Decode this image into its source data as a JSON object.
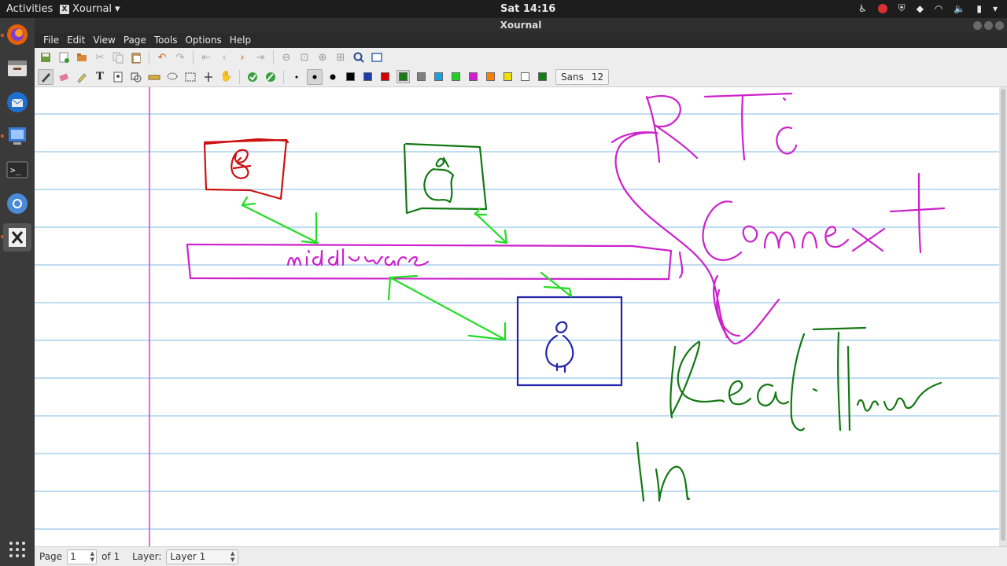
{
  "topbar": {
    "activities": "Activities",
    "app_name": "Xournal",
    "clock": "Sat 14:16"
  },
  "window": {
    "title": "Xournal"
  },
  "menu": {
    "items": [
      "File",
      "Edit",
      "View",
      "Page",
      "Tools",
      "Options",
      "Help"
    ]
  },
  "toolbar": {
    "font_name": "Sans",
    "font_size": "12",
    "colors": [
      "#000000",
      "#1f3da8",
      "#d60000",
      "#1a7a1a",
      "#808080",
      "#1aa0e0",
      "#22d022",
      "#d020d0",
      "#ff8000",
      "#f0e000",
      "#ffffff",
      "#128012"
    ],
    "selected_color": "#1a7a1a"
  },
  "statusbar": {
    "page_label": "Page",
    "page_value": "1",
    "page_of": "of 1",
    "layer_label": "Layer:",
    "layer_value": "Layer 1"
  },
  "canvas": {
    "rule_color": "#7cb8e6",
    "margin_color": "#d63cd6",
    "ink": {
      "red": "#cc1111",
      "green": "#127812",
      "magenta": "#cc22cc",
      "blue": "#2222aa",
      "bright_green": "#22dd22"
    }
  }
}
